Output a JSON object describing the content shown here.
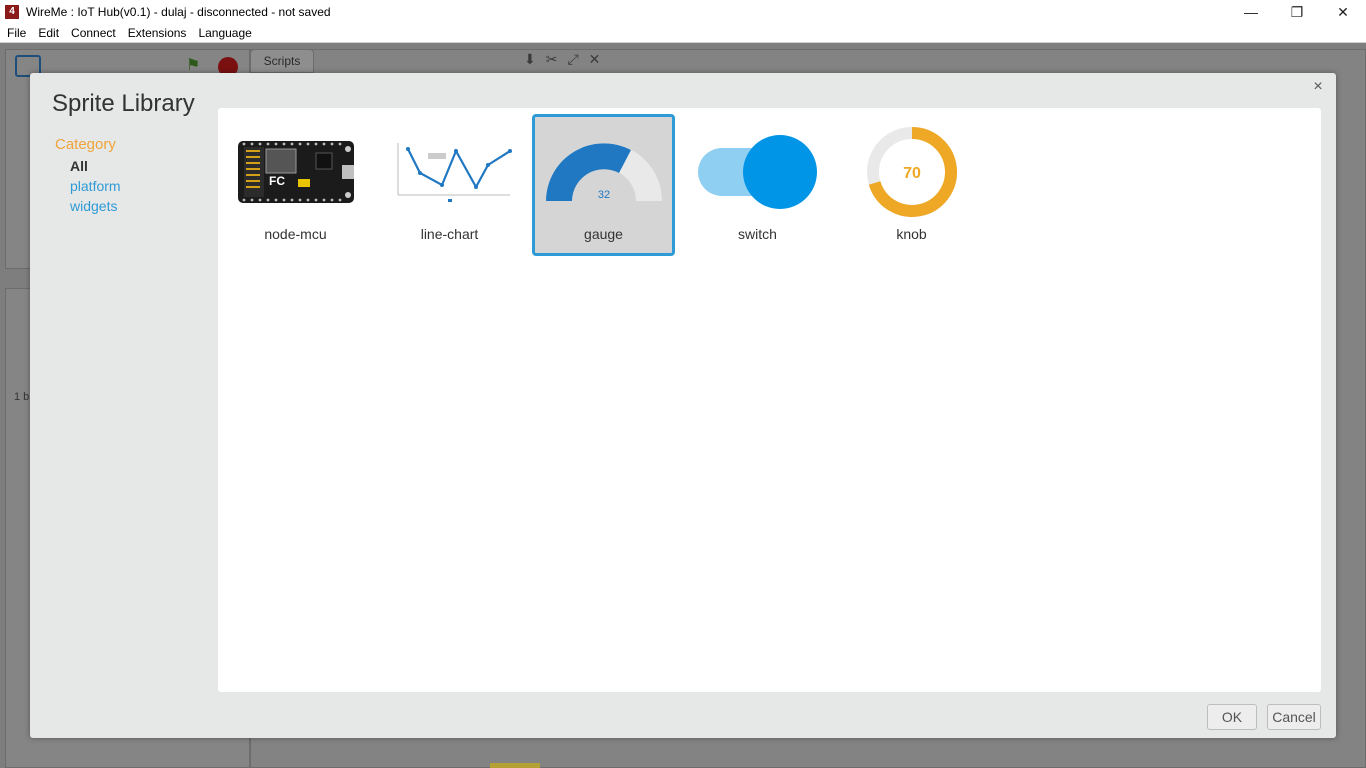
{
  "window": {
    "title": "WireMe : IoT Hub(v0.1) - dulaj - disconnected - not saved",
    "app_icon_glyph": "4",
    "minimize_glyph": "—",
    "maximize_glyph": "❐",
    "close_glyph": "✕"
  },
  "menu": [
    "File",
    "Edit",
    "Connect",
    "Extensions",
    "Language"
  ],
  "background": {
    "scripts_tab": "Scripts",
    "sprite_count_text": "1 b"
  },
  "dialog": {
    "title": "Sprite Library",
    "close_glyph": "×",
    "category_label": "Category",
    "categories": [
      "All",
      "platform",
      "widgets"
    ],
    "selected_category": "All",
    "sprites": [
      {
        "label": "node-mcu",
        "selected": false
      },
      {
        "label": "line-chart",
        "selected": false
      },
      {
        "label": "gauge",
        "selected": true,
        "value": "32"
      },
      {
        "label": "switch",
        "selected": false
      },
      {
        "label": "knob",
        "selected": false,
        "value": "70"
      }
    ],
    "ok_label": "OK",
    "cancel_label": "Cancel"
  },
  "colors": {
    "accent": "#2f9bd6",
    "category_heading": "#f0a43a",
    "gauge_fill": "#1f78c1",
    "switch_knob": "#0095e6",
    "switch_track": "#8fd0f2",
    "knob_ring": "#eea826"
  }
}
